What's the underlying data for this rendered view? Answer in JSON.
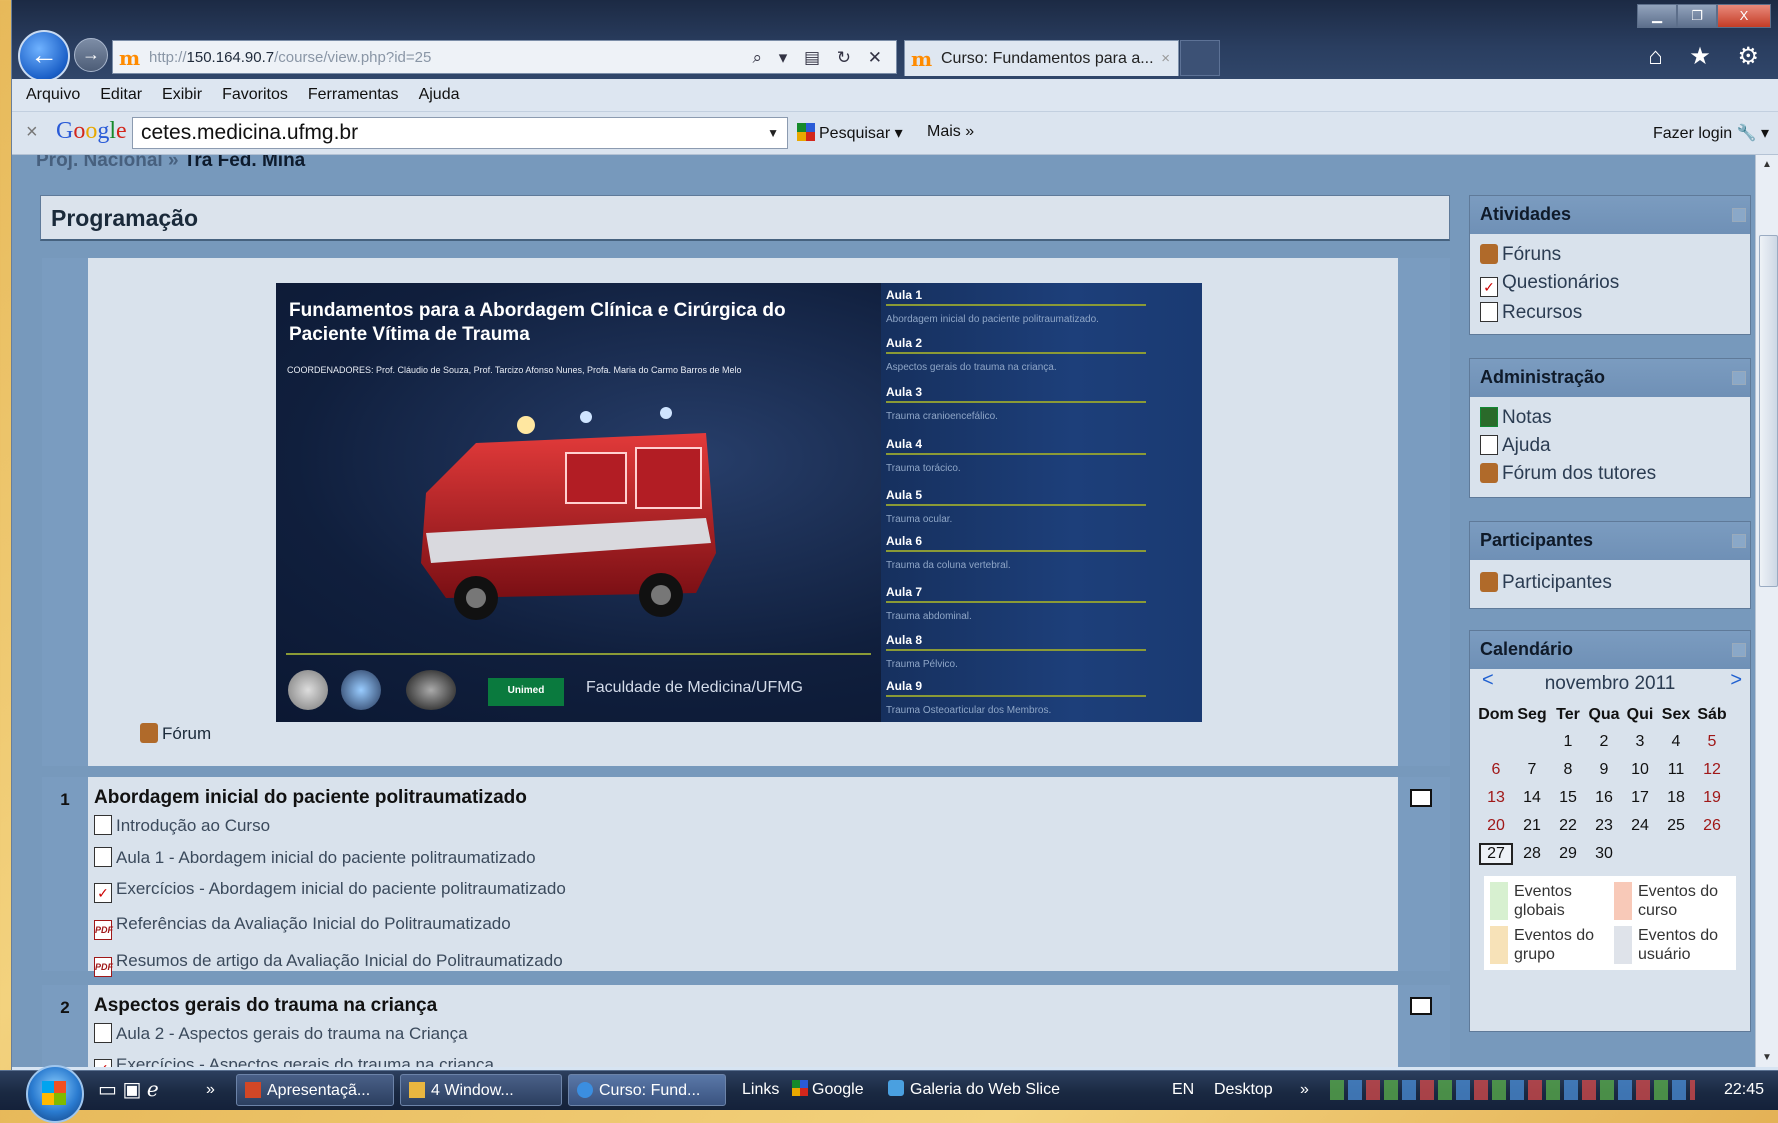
{
  "browser": {
    "url_prefix": "http://",
    "url_host": "150.164.90.7",
    "url_path": "/course/view.php?id=25",
    "tab_title": "Curso: Fundamentos para a...",
    "tab_close": "×",
    "window_controls": [
      "▁",
      "❐",
      "X"
    ],
    "toolbar_icons": "⌂ ★ ⚙",
    "addr_tools": "⌕ ▾ ▤ ↻ ✕"
  },
  "menu": [
    "Arquivo",
    "Editar",
    "Exibir",
    "Favoritos",
    "Ferramentas",
    "Ajuda"
  ],
  "google_toolbar": {
    "close": "×",
    "logo": [
      "G",
      "o",
      "o",
      "g",
      "l",
      "e"
    ],
    "search_value": "cetes.medicina.ufmg.br",
    "search_button": "Pesquisar ▾",
    "more": "Mais »",
    "login": "Fazer login 🔧 ▾"
  },
  "breadcrumb": {
    "parent": "Proj. Nacional",
    "sep": " » ",
    "current": "Tra Fed. Mina"
  },
  "section_title": "Programação",
  "banner": {
    "title": "Fundamentos para a Abordagem Clínica e Cirúrgica do Paciente Vítima de Trauma",
    "coordinators": "COORDENADORES: Prof. Cláudio de Souza, Prof. Tarcizo Afonso Nunes, Profa. Maria do Carmo Barros de Melo",
    "faculty": "Faculdade de Medicina/UFMG",
    "unimed": "Unimed",
    "aulas": [
      {
        "title": "Aula 1",
        "desc": "Abordagem inicial do paciente politraumatizado."
      },
      {
        "title": "Aula 2",
        "desc": "Aspectos gerais do trauma na criança."
      },
      {
        "title": "Aula 3",
        "desc": "Trauma cranioencefálico."
      },
      {
        "title": "Aula 4",
        "desc": "Trauma torácico."
      },
      {
        "title": "Aula 5",
        "desc": "Trauma ocular."
      },
      {
        "title": "Aula 6",
        "desc": "Trauma da coluna vertebral."
      },
      {
        "title": "Aula 7",
        "desc": "Trauma abdominal."
      },
      {
        "title": "Aula 8",
        "desc": "Trauma Pélvico."
      },
      {
        "title": "Aula 9",
        "desc": "Trauma Osteoarticular dos Membros."
      }
    ]
  },
  "forum_link": "Fórum",
  "topics": [
    {
      "number": "1",
      "title": "Abordagem inicial do paciente politraumatizado",
      "items": [
        {
          "icon": "doc",
          "label": "Introdução ao Curso"
        },
        {
          "icon": "doc",
          "label": "Aula 1 - Abordagem inicial do paciente politraumatizado"
        },
        {
          "icon": "quiz",
          "label": "Exercícios - Abordagem inicial do paciente politraumatizado"
        },
        {
          "icon": "pdf",
          "label": "Referências da Avaliação Inicial do Politraumatizado"
        },
        {
          "icon": "pdf",
          "label": "Resumos de artigo da Avaliação Inicial do Politraumatizado"
        }
      ]
    },
    {
      "number": "2",
      "title": "Aspectos gerais do trauma na criança",
      "items": [
        {
          "icon": "doc",
          "label": "Aula 2 - Aspectos gerais do trauma na Criança"
        },
        {
          "icon": "quiz",
          "label": "Exercícios - Aspectos gerais do trauma na criança"
        }
      ]
    }
  ],
  "blocks": {
    "atividades": {
      "title": "Atividades",
      "items": [
        "Fóruns",
        "Questionários",
        "Recursos"
      ]
    },
    "administracao": {
      "title": "Administração",
      "items": [
        "Notas",
        "Ajuda",
        "Fórum dos tutores"
      ]
    },
    "participantes": {
      "title": "Participantes",
      "items": [
        "Participantes"
      ]
    },
    "calendario": {
      "title": "Calendário",
      "prev": "<",
      "next": ">",
      "month": "novembro 2011",
      "weekdays": [
        "Dom",
        "Seg",
        "Ter",
        "Qua",
        "Qui",
        "Sex",
        "Sáb"
      ],
      "weeks": [
        [
          "",
          "",
          "1",
          "2",
          "3",
          "4",
          "5"
        ],
        [
          "6",
          "7",
          "8",
          "9",
          "10",
          "11",
          "12"
        ],
        [
          "13",
          "14",
          "15",
          "16",
          "17",
          "18",
          "19"
        ],
        [
          "20",
          "21",
          "22",
          "23",
          "24",
          "25",
          "26"
        ],
        [
          "27",
          "28",
          "29",
          "30",
          "",
          "",
          ""
        ]
      ],
      "today": "27",
      "legend": [
        {
          "label": "Eventos globais",
          "color": "#d7f0d0"
        },
        {
          "label": "Eventos do curso",
          "color": "#f8c9b8"
        },
        {
          "label": "Eventos do grupo",
          "color": "#f7e2b8"
        },
        {
          "label": "Eventos do usuário",
          "color": "#dfe3ea"
        }
      ]
    }
  },
  "taskbar": {
    "chevron": "»",
    "buttons": [
      "Apresentaçã...",
      "4 Window...",
      "Curso: Fund..."
    ],
    "links": "Links",
    "google": "Google",
    "galeria": "Galeria do Web Slice",
    "lang": "EN",
    "desktop": "Desktop",
    "clock": "22:45"
  },
  "colors": {
    "page_bg": "#7799bc",
    "block_header": "#7b9cc0",
    "weekend": "#a01818"
  }
}
